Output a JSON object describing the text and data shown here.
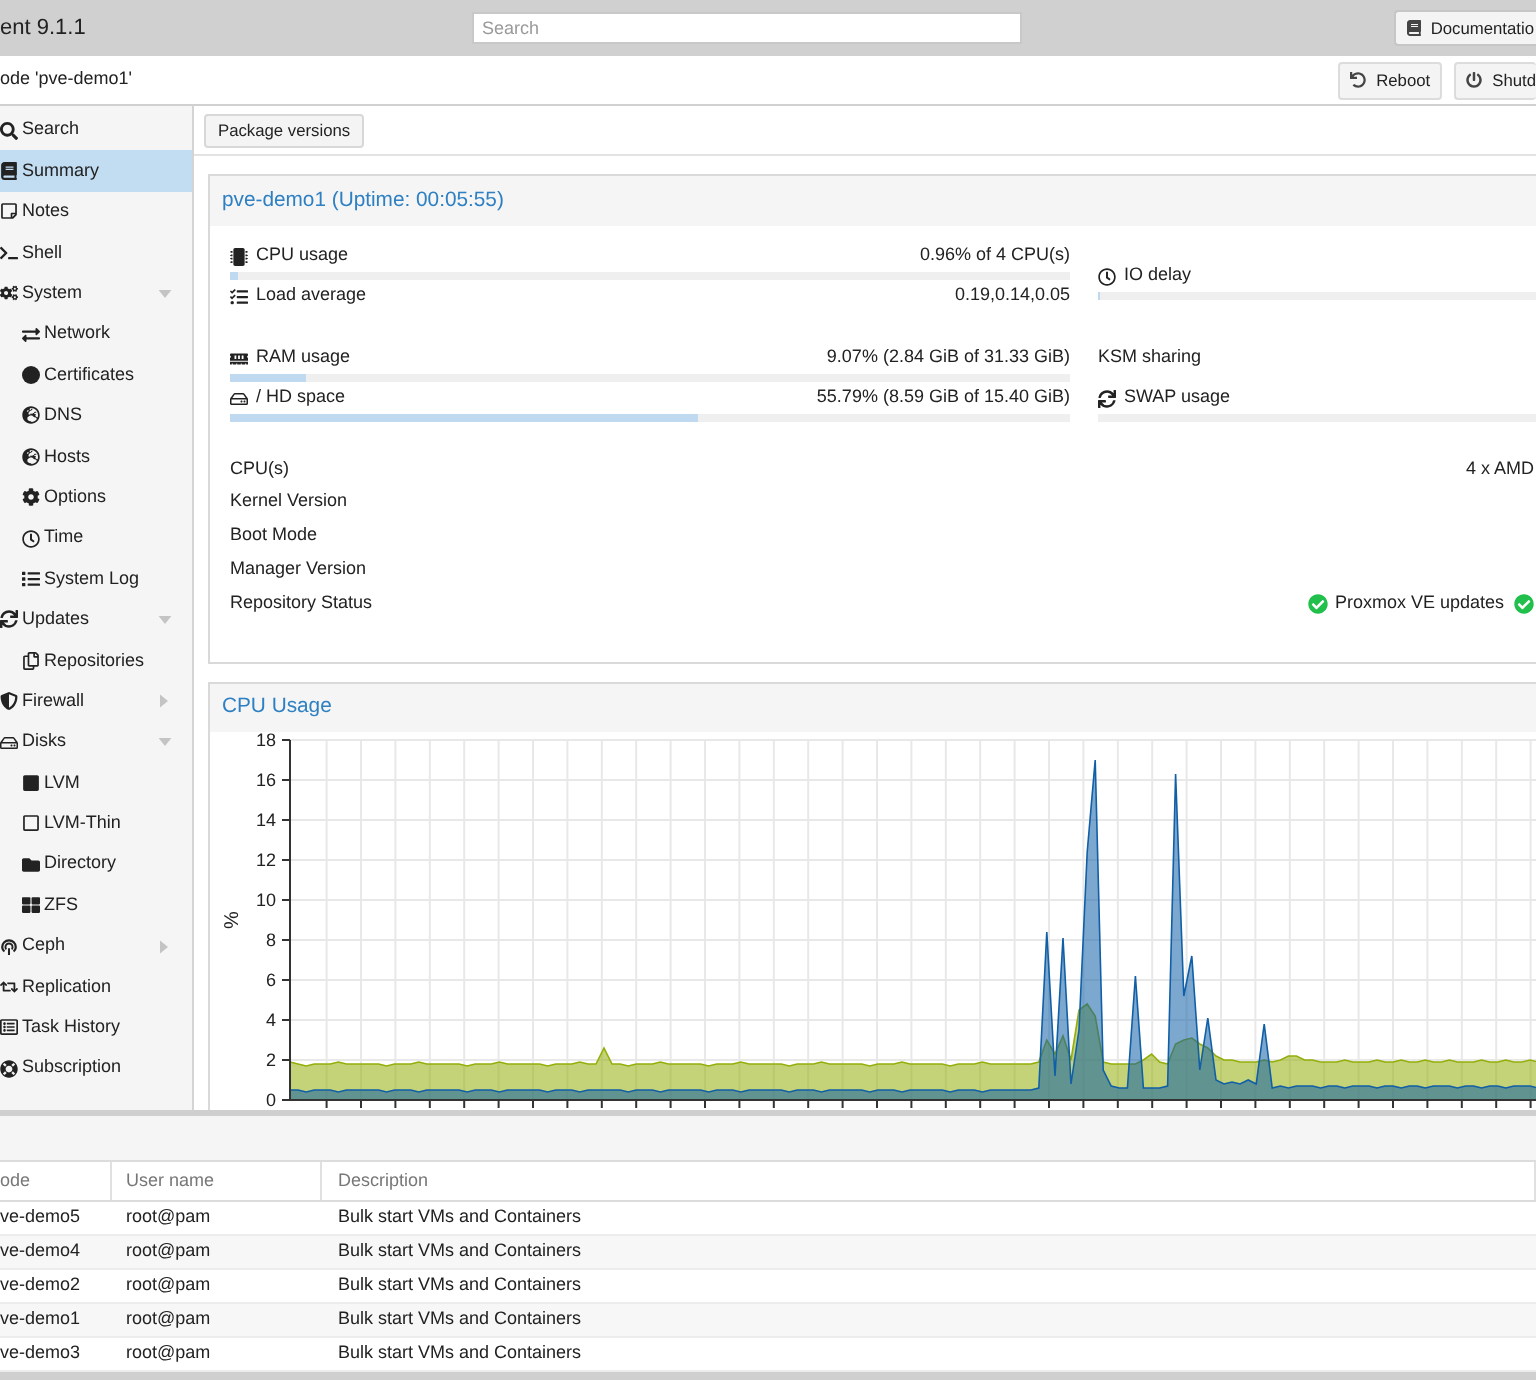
{
  "header": {
    "title": "ent 9.1.1",
    "search": {
      "placeholder": "Search"
    },
    "buttons": [
      {
        "label": "Documentatio"
      }
    ]
  },
  "node_bar": {
    "title": "ode 'pve-demo1'",
    "buttons": [
      {
        "label": "Reboot"
      },
      {
        "label": "Shutd"
      }
    ]
  },
  "sidebar": {
    "items": [
      {
        "label": "Search",
        "selected": false
      },
      {
        "label": "Summary",
        "selected": true
      },
      {
        "label": "Notes",
        "selected": false
      },
      {
        "label": "Shell",
        "selected": false
      },
      {
        "label": "System",
        "selected": false,
        "expanded": true,
        "children": [
          {
            "label": "Network",
            "selected": false
          },
          {
            "label": "Certificates",
            "selected": false
          },
          {
            "label": "DNS",
            "selected": false
          },
          {
            "label": "Hosts",
            "selected": false
          },
          {
            "label": "Options",
            "selected": false
          },
          {
            "label": "Time",
            "selected": false
          },
          {
            "label": "System Log",
            "selected": false
          }
        ]
      },
      {
        "label": "Updates",
        "selected": false,
        "expanded": true,
        "children": [
          {
            "label": "Repositories",
            "selected": false
          }
        ]
      },
      {
        "label": "Firewall",
        "selected": false,
        "expanded": false
      },
      {
        "label": "Disks",
        "selected": false,
        "expanded": true,
        "children": [
          {
            "label": "LVM",
            "selected": false
          },
          {
            "label": "LVM-Thin",
            "selected": false
          },
          {
            "label": "Directory",
            "selected": false
          },
          {
            "label": "ZFS",
            "selected": false
          }
        ]
      },
      {
        "label": "Ceph",
        "selected": false,
        "expanded": false
      },
      {
        "label": "Replication",
        "selected": false
      },
      {
        "label": "Task History",
        "selected": false
      },
      {
        "label": "Subscription",
        "selected": false
      }
    ]
  },
  "toolbar": {
    "buttons": [
      {
        "label": "Package versions"
      }
    ]
  },
  "summary_panel": {
    "title": "pve-demo1 (Uptime: 00:05:55)",
    "stat_groups": [
      {
        "left": [
          {
            "kind": "meter",
            "label": "CPU usage",
            "value": "0.96% of 4 CPU(s)",
            "level": 0.0096
          },
          {
            "kind": "text",
            "label": "Load average",
            "value": "0.19,0.14,0.05"
          }
        ],
        "right": [
          {
            "kind": "meter",
            "label": "IO delay",
            "level": 0.004
          }
        ]
      },
      {
        "left": [
          {
            "kind": "meter",
            "label": "RAM usage",
            "value": "9.07% (2.84 GiB of 31.33 GiB)",
            "level": 0.0907
          },
          {
            "kind": "meter",
            "label": "/ HD space",
            "value": "55.79% (8.59 GiB of 15.40 GiB)",
            "level": 0.5579
          }
        ],
        "right": [
          {
            "kind": "text",
            "label": "KSM sharing"
          },
          {
            "kind": "meter",
            "label": "SWAP usage"
          }
        ]
      }
    ],
    "info_rows": [
      {
        "label": "CPU(s)",
        "value": "4 x AMD"
      },
      {
        "label": "Kernel Version"
      },
      {
        "label": "Boot Mode"
      },
      {
        "label": "Manager Version"
      },
      {
        "label": "Repository Status",
        "statuses": [
          {
            "kind": "ok",
            "text": "Proxmox VE updates"
          },
          {
            "kind": "ok"
          }
        ]
      }
    ]
  },
  "cpu_panel": {
    "chart_data": {
      "type": "area",
      "title": "CPU Usage",
      "ylabel": "%",
      "ylim": [
        0,
        18
      ],
      "yticks": [
        0,
        2,
        4,
        6,
        8,
        10,
        12,
        14,
        16,
        18
      ],
      "grid": true,
      "series": [
        {
          "color": "#94ae0a",
          "values": [
            1.9,
            1.8,
            1.7,
            1.8,
            1.8,
            1.8,
            1.9,
            1.8,
            1.8,
            1.8,
            1.8,
            1.8,
            1.7,
            1.8,
            1.8,
            1.8,
            1.9,
            1.8,
            1.8,
            1.8,
            1.8,
            1.8,
            1.7,
            1.8,
            1.8,
            1.8,
            1.9,
            1.8,
            1.8,
            1.8,
            1.8,
            1.8,
            1.7,
            1.8,
            1.8,
            1.8,
            1.9,
            1.8,
            1.8,
            2.6,
            1.8,
            1.8,
            1.7,
            1.8,
            1.8,
            1.8,
            1.9,
            1.8,
            1.8,
            1.8,
            1.8,
            1.8,
            1.7,
            1.8,
            1.8,
            1.8,
            1.9,
            1.8,
            1.8,
            1.8,
            1.8,
            1.8,
            1.7,
            1.8,
            1.8,
            1.8,
            1.9,
            1.8,
            1.8,
            1.8,
            1.8,
            1.8,
            1.7,
            1.8,
            1.8,
            1.8,
            1.9,
            1.8,
            1.8,
            1.8,
            1.8,
            1.8,
            1.7,
            1.8,
            1.8,
            1.8,
            1.9,
            1.8,
            1.8,
            1.8,
            1.8,
            1.8,
            1.8,
            1.9,
            3.0,
            2.3,
            3.2,
            2.0,
            4.5,
            4.8,
            4.2,
            1.9,
            1.8,
            1.8,
            1.8,
            1.8,
            2.0,
            2.3,
            1.9,
            1.8,
            2.8,
            3.0,
            3.1,
            2.8,
            2.6,
            2.2,
            2.0,
            2.0,
            1.9,
            1.9,
            1.9,
            2.0,
            1.9,
            2.0,
            2.2,
            2.2,
            2.0,
            2.0,
            1.9,
            1.9,
            1.9,
            2.0,
            1.9,
            1.9,
            1.9,
            2.0,
            1.9,
            1.9,
            2.0,
            1.9,
            1.9,
            2.0,
            1.9,
            1.9,
            2.0,
            1.9,
            1.9,
            1.9,
            2.0,
            1.9,
            1.9,
            2.0,
            1.9,
            1.9,
            2.0,
            1.9
          ]
        },
        {
          "color": "#115fa6",
          "values": [
            0.5,
            0.5,
            0.4,
            0.5,
            0.5,
            0.5,
            0.4,
            0.5,
            0.5,
            0.5,
            0.5,
            0.5,
            0.4,
            0.5,
            0.5,
            0.5,
            0.4,
            0.5,
            0.5,
            0.5,
            0.5,
            0.5,
            0.4,
            0.5,
            0.5,
            0.5,
            0.4,
            0.5,
            0.5,
            0.5,
            0.5,
            0.5,
            0.4,
            0.5,
            0.5,
            0.5,
            0.4,
            0.5,
            0.5,
            0.5,
            0.5,
            0.5,
            0.4,
            0.5,
            0.5,
            0.5,
            0.4,
            0.5,
            0.5,
            0.5,
            0.5,
            0.5,
            0.4,
            0.5,
            0.5,
            0.5,
            0.4,
            0.5,
            0.5,
            0.5,
            0.5,
            0.5,
            0.4,
            0.5,
            0.5,
            0.5,
            0.4,
            0.5,
            0.5,
            0.5,
            0.5,
            0.5,
            0.4,
            0.5,
            0.5,
            0.5,
            0.4,
            0.5,
            0.5,
            0.5,
            0.5,
            0.5,
            0.4,
            0.5,
            0.5,
            0.5,
            0.4,
            0.5,
            0.5,
            0.5,
            0.5,
            0.5,
            0.5,
            0.6,
            8.4,
            1.2,
            8.1,
            0.8,
            3.5,
            12.4,
            17.0,
            1.5,
            0.7,
            0.6,
            0.6,
            6.2,
            0.6,
            0.6,
            0.6,
            0.7,
            16.3,
            5.2,
            7.2,
            1.5,
            4.1,
            1.0,
            0.8,
            0.9,
            0.8,
            1.0,
            0.8,
            3.8,
            0.6,
            0.7,
            0.6,
            0.7,
            0.7,
            0.7,
            0.6,
            0.7,
            0.7,
            0.6,
            0.7,
            0.7,
            0.7,
            0.6,
            0.7,
            0.7,
            0.6,
            0.7,
            0.7,
            0.6,
            0.7,
            0.7,
            0.7,
            0.6,
            0.7,
            0.7,
            0.6,
            0.7,
            0.7,
            0.6,
            0.7,
            0.7,
            0.7,
            0.6
          ]
        }
      ]
    }
  },
  "task_table": {
    "columns": [
      "ode",
      "User name",
      "Description"
    ],
    "rows": [
      [
        "ve-demo5",
        "root@pam",
        "Bulk start VMs and Containers"
      ],
      [
        "ve-demo4",
        "root@pam",
        "Bulk start VMs and Containers"
      ],
      [
        "ve-demo2",
        "root@pam",
        "Bulk start VMs and Containers"
      ],
      [
        "ve-demo1",
        "root@pam",
        "Bulk start VMs and Containers"
      ],
      [
        "ve-demo3",
        "root@pam",
        "Bulk start VMs and Containers"
      ]
    ]
  }
}
